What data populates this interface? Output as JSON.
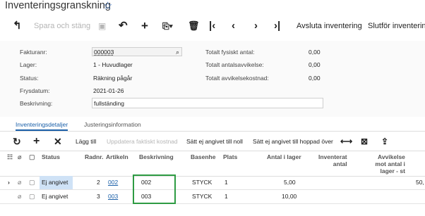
{
  "header": {
    "title": "Inventeringsgranskning"
  },
  "toolbar": {
    "save_label": "Spara och stäng",
    "complete_label": "Avsluta inventering",
    "finish_label": "Slutför inventering"
  },
  "form": {
    "labels": {
      "invoice": "Fakturanr:",
      "warehouse": "Lager:",
      "status": "Status:",
      "freeze_date": "Frysdatum:",
      "description": "Beskrivning:",
      "total_physical": "Totalt fysiskt antal:",
      "total_qty_variance": "Totalt antalsavvikelse:",
      "total_cost_variance": "Totalt avvikelsekostnad:"
    },
    "values": {
      "invoice": "000003",
      "warehouse": "1 - Huvudlager",
      "status": "Räkning pågår",
      "freeze_date": "2021-01-26",
      "description": "fullständing",
      "total_physical": "0,00",
      "total_qty_variance": "0,00",
      "total_cost_variance": "0,00"
    }
  },
  "tabs": [
    {
      "label": "Inventeringsdetaljer",
      "active": true
    },
    {
      "label": "Justeringsinformation",
      "active": false
    }
  ],
  "grid_toolbar": {
    "add_line": "Lägg till",
    "update_qty": "Uppdatera faktiskt kostnad",
    "set_null": "Sätt ej angivet till noll",
    "set_skipped": "Sätt ej angivet till hoppad över"
  },
  "grid": {
    "columns": {
      "status": "Status",
      "line": "Radnr.",
      "item": "Artikeln",
      "description": "Beskrivning",
      "base": "Basenhe",
      "location": "Plats",
      "book_qty": "Antal i lager",
      "counted_l1": "Inventerat",
      "counted_l2": "antal",
      "var_l1": "Avvikelse",
      "var_l2": "mot antal i",
      "var_l3": "lager - st"
    },
    "rows": [
      {
        "status": "Ej angivet",
        "line": "2",
        "item": "002",
        "description": "002",
        "base": "STYCK",
        "location": "1",
        "book_qty": "5,00",
        "extra": "50,"
      },
      {
        "status": "Ej angivet",
        "line": "3",
        "item": "003",
        "description": "003",
        "base": "STYCK",
        "location": "1",
        "book_qty": "10,00",
        "extra": ""
      }
    ]
  }
}
